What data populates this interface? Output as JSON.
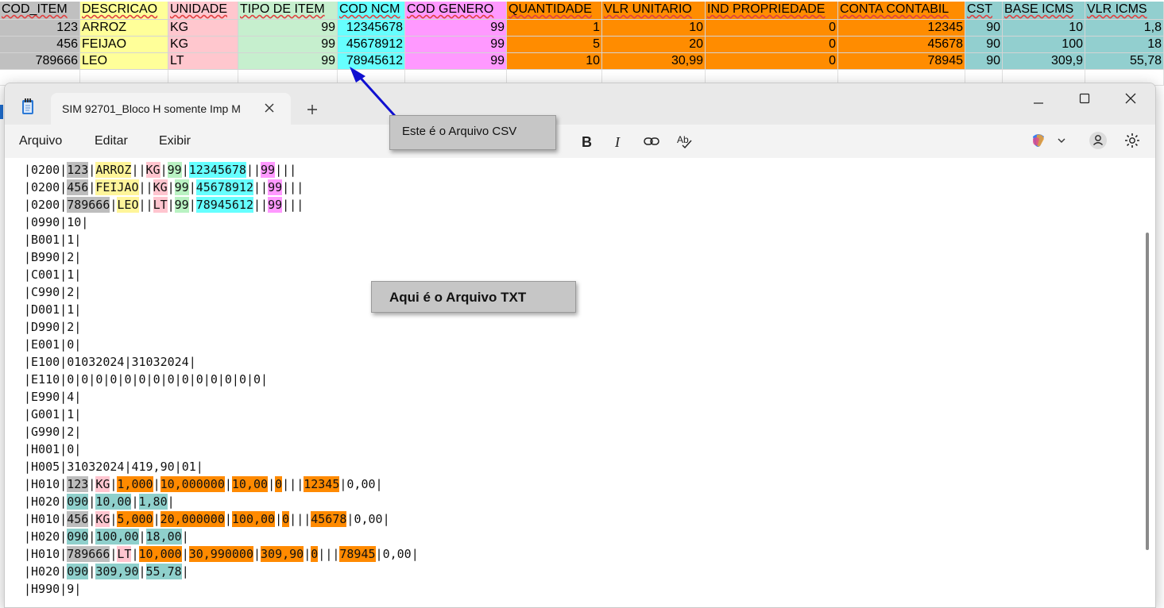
{
  "sheet": {
    "headers": [
      "COD_ITEM",
      "DESCRICAO",
      "UNIDADE",
      "TIPO DE ITEM",
      "COD NCM",
      "COD GENERO",
      "QUANTIDADE",
      "VLR UNITARIO",
      "IND PROPRIEDADE",
      "CONTA CONTABIL",
      "CST",
      "BASE ICMS",
      "VLR ICMS"
    ],
    "rows": [
      [
        "123",
        "ARROZ",
        "KG",
        "99",
        "12345678",
        "99",
        "1",
        "10",
        "0",
        "12345",
        "90",
        "10",
        "1,8"
      ],
      [
        "456",
        "FEIJAO",
        "KG",
        "99",
        "45678912",
        "99",
        "5",
        "20",
        "0",
        "45678",
        "90",
        "100",
        "18"
      ],
      [
        "789666",
        "LEO",
        "LT",
        "99",
        "78945612",
        "99",
        "10",
        "30,99",
        "0",
        "78945",
        "90",
        "309,9",
        "55,78"
      ]
    ],
    "column_colors": [
      "#c0c0c0",
      "#ffff99",
      "#ffc7ce",
      "#c6efce",
      "#66ffff",
      "#ff99ff",
      "#ff8c00",
      "#ff8c00",
      "#ff8c00",
      "#ff8c00",
      "#92cfcf",
      "#92cfcf",
      "#92cfcf"
    ],
    "callout_csv": "Este é o Arquivo CSV"
  },
  "notepad": {
    "tab_title": "SIM 92701_Bloco H somente Imp M",
    "menu": [
      "Arquivo",
      "Editar",
      "Exibir"
    ],
    "callout_txt": "Aqui é o Arquivo TXT",
    "colors": {
      "gray": "#bdbdbd",
      "yellow": "#fff59a",
      "pink": "#ffc5cf",
      "green": "#b9f2c2",
      "cyan": "#66ffff",
      "magenta": "#ff99ff",
      "orange": "#ff8a00",
      "teal": "#8fd0cc"
    },
    "lines": [
      [
        [
          "0200",
          null
        ],
        [
          "123",
          "gray"
        ],
        [
          "ARROZ",
          "yellow"
        ],
        [
          "",
          null
        ],
        [
          "KG",
          "pink"
        ],
        [
          "99",
          "green"
        ],
        [
          "12345678",
          "cyan"
        ],
        [
          "",
          null
        ],
        [
          "99",
          "magenta"
        ],
        [
          "",
          null
        ],
        [
          "",
          null
        ]
      ],
      [
        [
          "0200",
          null
        ],
        [
          "456",
          "gray"
        ],
        [
          "FEIJAO",
          "yellow"
        ],
        [
          "",
          null
        ],
        [
          "KG",
          "pink"
        ],
        [
          "99",
          "green"
        ],
        [
          "45678912",
          "cyan"
        ],
        [
          "",
          null
        ],
        [
          "99",
          "magenta"
        ],
        [
          "",
          null
        ],
        [
          "",
          null
        ]
      ],
      [
        [
          "0200",
          null
        ],
        [
          "789666",
          "gray"
        ],
        [
          "LEO",
          "yellow"
        ],
        [
          "",
          null
        ],
        [
          "LT",
          "pink"
        ],
        [
          "99",
          "green"
        ],
        [
          "78945612",
          "cyan"
        ],
        [
          "",
          null
        ],
        [
          "99",
          "magenta"
        ],
        [
          "",
          null
        ],
        [
          "",
          null
        ]
      ],
      [
        [
          "0990",
          null
        ],
        [
          "10",
          null
        ]
      ],
      [
        [
          "B001",
          null
        ],
        [
          "1",
          null
        ]
      ],
      [
        [
          "B990",
          null
        ],
        [
          "2",
          null
        ]
      ],
      [
        [
          "C001",
          null
        ],
        [
          "1",
          null
        ]
      ],
      [
        [
          "C990",
          null
        ],
        [
          "2",
          null
        ]
      ],
      [
        [
          "D001",
          null
        ],
        [
          "1",
          null
        ]
      ],
      [
        [
          "D990",
          null
        ],
        [
          "2",
          null
        ]
      ],
      [
        [
          "E001",
          null
        ],
        [
          "0",
          null
        ]
      ],
      [
        [
          "E100",
          null
        ],
        [
          "01032024",
          null
        ],
        [
          "31032024",
          null
        ]
      ],
      [
        [
          "E110",
          null
        ],
        [
          "0",
          null
        ],
        [
          "0",
          null
        ],
        [
          "0",
          null
        ],
        [
          "0",
          null
        ],
        [
          "0",
          null
        ],
        [
          "0",
          null
        ],
        [
          "0",
          null
        ],
        [
          "0",
          null
        ],
        [
          "0",
          null
        ],
        [
          "0",
          null
        ],
        [
          "0",
          null
        ],
        [
          "0",
          null
        ],
        [
          "0",
          null
        ],
        [
          "0",
          null
        ]
      ],
      [
        [
          "E990",
          null
        ],
        [
          "4",
          null
        ]
      ],
      [
        [
          "G001",
          null
        ],
        [
          "1",
          null
        ]
      ],
      [
        [
          "G990",
          null
        ],
        [
          "2",
          null
        ]
      ],
      [
        [
          "H001",
          null
        ],
        [
          "0",
          null
        ]
      ],
      [
        [
          "H005",
          null
        ],
        [
          "31032024",
          null
        ],
        [
          "419,90",
          null
        ],
        [
          "01",
          null
        ]
      ],
      [
        [
          "H010",
          null
        ],
        [
          "123",
          "gray"
        ],
        [
          "KG",
          "pink"
        ],
        [
          "1,000",
          "orange"
        ],
        [
          "10,000000",
          "orange"
        ],
        [
          "10,00",
          "orange"
        ],
        [
          "0",
          "orange"
        ],
        [
          "",
          null
        ],
        [
          "",
          null
        ],
        [
          "12345",
          "orange"
        ],
        [
          "0,00",
          null
        ]
      ],
      [
        [
          "H020",
          null
        ],
        [
          "090",
          "teal"
        ],
        [
          "10,00",
          "teal"
        ],
        [
          "1,80",
          "teal"
        ]
      ],
      [
        [
          "H010",
          null
        ],
        [
          "456",
          "gray"
        ],
        [
          "KG",
          "pink"
        ],
        [
          "5,000",
          "orange"
        ],
        [
          "20,000000",
          "orange"
        ],
        [
          "100,00",
          "orange"
        ],
        [
          "0",
          "orange"
        ],
        [
          "",
          null
        ],
        [
          "",
          null
        ],
        [
          "45678",
          "orange"
        ],
        [
          "0,00",
          null
        ]
      ],
      [
        [
          "H020",
          null
        ],
        [
          "090",
          "teal"
        ],
        [
          "100,00",
          "teal"
        ],
        [
          "18,00",
          "teal"
        ]
      ],
      [
        [
          "H010",
          null
        ],
        [
          "789666",
          "gray"
        ],
        [
          "LT",
          "pink"
        ],
        [
          "10,000",
          "orange"
        ],
        [
          "30,990000",
          "orange"
        ],
        [
          "309,90",
          "orange"
        ],
        [
          "0",
          "orange"
        ],
        [
          "",
          null
        ],
        [
          "",
          null
        ],
        [
          "78945",
          "orange"
        ],
        [
          "0,00",
          null
        ]
      ],
      [
        [
          "H020",
          null
        ],
        [
          "090",
          "teal"
        ],
        [
          "309,90",
          "teal"
        ],
        [
          "55,78",
          "teal"
        ]
      ],
      [
        [
          "H990",
          null
        ],
        [
          "9",
          null
        ]
      ]
    ]
  }
}
